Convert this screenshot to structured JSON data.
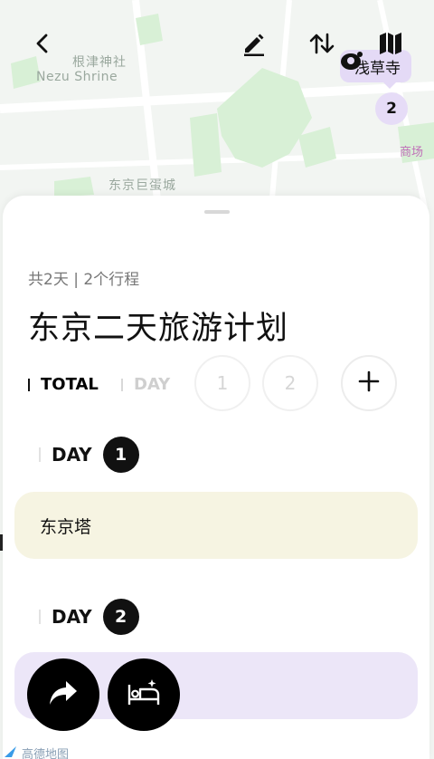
{
  "map": {
    "label_nezu_zh": "根津神社",
    "label_nezu_en": "Nezu Shrine",
    "label_dome": "东京巨蛋城",
    "label_mall": "商场",
    "poi_name": "浅草寺",
    "poi_count": "2",
    "attribution": "高德地图"
  },
  "toolbar": {
    "back_icon": "chevron-left",
    "edit_icon": "pencil",
    "sort_icon": "swap-vertical",
    "map_icon": "folded-map"
  },
  "plan": {
    "meta": "共2天 | 2个行程",
    "title": "东京二天旅游计划"
  },
  "tabs": {
    "total_label": "TOTAL",
    "day_label": "DAY",
    "day_buttons": [
      "1",
      "2"
    ],
    "add_icon": "plus"
  },
  "days": [
    {
      "label": "DAY",
      "number": "1",
      "items": [
        "东京塔"
      ]
    },
    {
      "label": "DAY",
      "number": "2",
      "items": [
        ""
      ]
    }
  ],
  "fabs": {
    "share_icon": "share-arrow",
    "hotel_icon": "bed-sparkle"
  },
  "colors": {
    "accent_purple": "#e4daf6",
    "card_yellow": "#f6f4e2",
    "card_purple": "#ece6f8",
    "map_green": "#d8f0d6"
  }
}
